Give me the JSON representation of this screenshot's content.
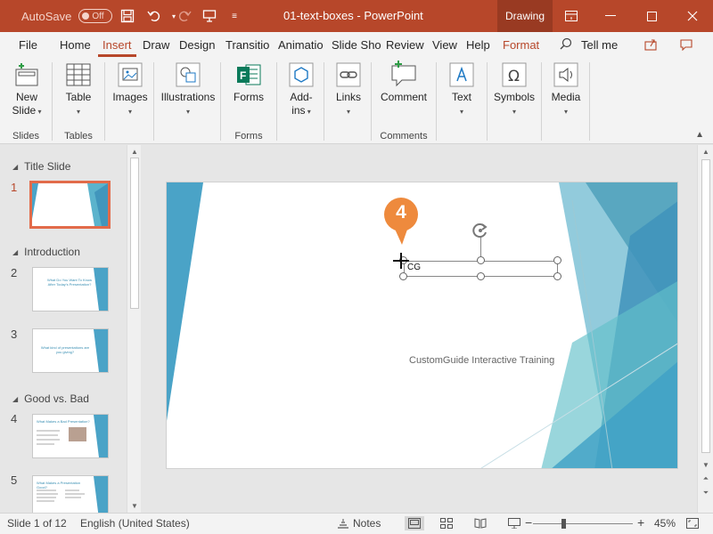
{
  "titlebar": {
    "autosave_label": "AutoSave",
    "autosave_state": "Off",
    "doc_title": "01-text-boxes  -  PowerPoint",
    "context_tab": "Drawing",
    "icons": [
      "save-icon",
      "undo-icon",
      "redo-icon",
      "presenter-icon",
      "customize-icon"
    ],
    "window_controls": [
      "ribbon-display-icon",
      "minimize-icon",
      "maximize-icon",
      "close-icon"
    ]
  },
  "tabs": [
    "File",
    "Home",
    "Insert",
    "Draw",
    "Design",
    "Transitio",
    "Animatio",
    "Slide Sho",
    "Review",
    "View",
    "Help",
    "Format"
  ],
  "active_tab": "Insert",
  "tell_me": "Tell me",
  "ribbon": {
    "groups": [
      {
        "label": "Slides",
        "buttons": [
          {
            "label": "New",
            "label2": "Slide",
            "icon": "new-slide-icon"
          }
        ]
      },
      {
        "label": "Tables",
        "buttons": [
          {
            "label": "Table",
            "icon": "table-icon"
          }
        ]
      },
      {
        "label": "",
        "buttons": [
          {
            "label": "Images",
            "icon": "images-icon"
          }
        ]
      },
      {
        "label": "",
        "buttons": [
          {
            "label": "Illustrations",
            "icon": "illustrations-icon"
          }
        ]
      },
      {
        "label": "Forms",
        "buttons": [
          {
            "label": "Forms",
            "icon": "forms-icon"
          }
        ]
      },
      {
        "label": "",
        "buttons": [
          {
            "label": "Add-",
            "label2": "ins",
            "icon": "add-ins-icon"
          }
        ]
      },
      {
        "label": "",
        "buttons": [
          {
            "label": "Links",
            "icon": "links-icon"
          }
        ]
      },
      {
        "label": "Comments",
        "buttons": [
          {
            "label": "Comment",
            "icon": "comment-icon"
          }
        ]
      },
      {
        "label": "",
        "buttons": [
          {
            "label": "Text",
            "icon": "text-icon"
          }
        ]
      },
      {
        "label": "",
        "buttons": [
          {
            "label": "Symbols",
            "icon": "symbols-icon"
          }
        ]
      },
      {
        "label": "",
        "buttons": [
          {
            "label": "Media",
            "icon": "media-icon"
          }
        ]
      }
    ]
  },
  "thumbnails": {
    "sections": [
      "Title Slide",
      "Introduction",
      "Good vs. Bad"
    ],
    "slides": [
      {
        "num": "1",
        "text": ""
      },
      {
        "num": "2",
        "text": "What Do You Want To Know After Today's Presentation?"
      },
      {
        "num": "3",
        "text": "What kind of presentations are you giving?"
      },
      {
        "num": "4",
        "text": "What Makes a Bad Presentation?"
      },
      {
        "num": "5",
        "text": "What Makes a Presentation Good?"
      }
    ]
  },
  "slide": {
    "subtitle": "CustomGuide Interactive Training",
    "textbox_text": "CG",
    "callout_number": "4"
  },
  "statusbar": {
    "slide_info": "Slide 1 of 12",
    "language": "English (United States)",
    "notes": "Notes",
    "zoom": "45%",
    "zoom_out": "−",
    "zoom_in": "+"
  }
}
